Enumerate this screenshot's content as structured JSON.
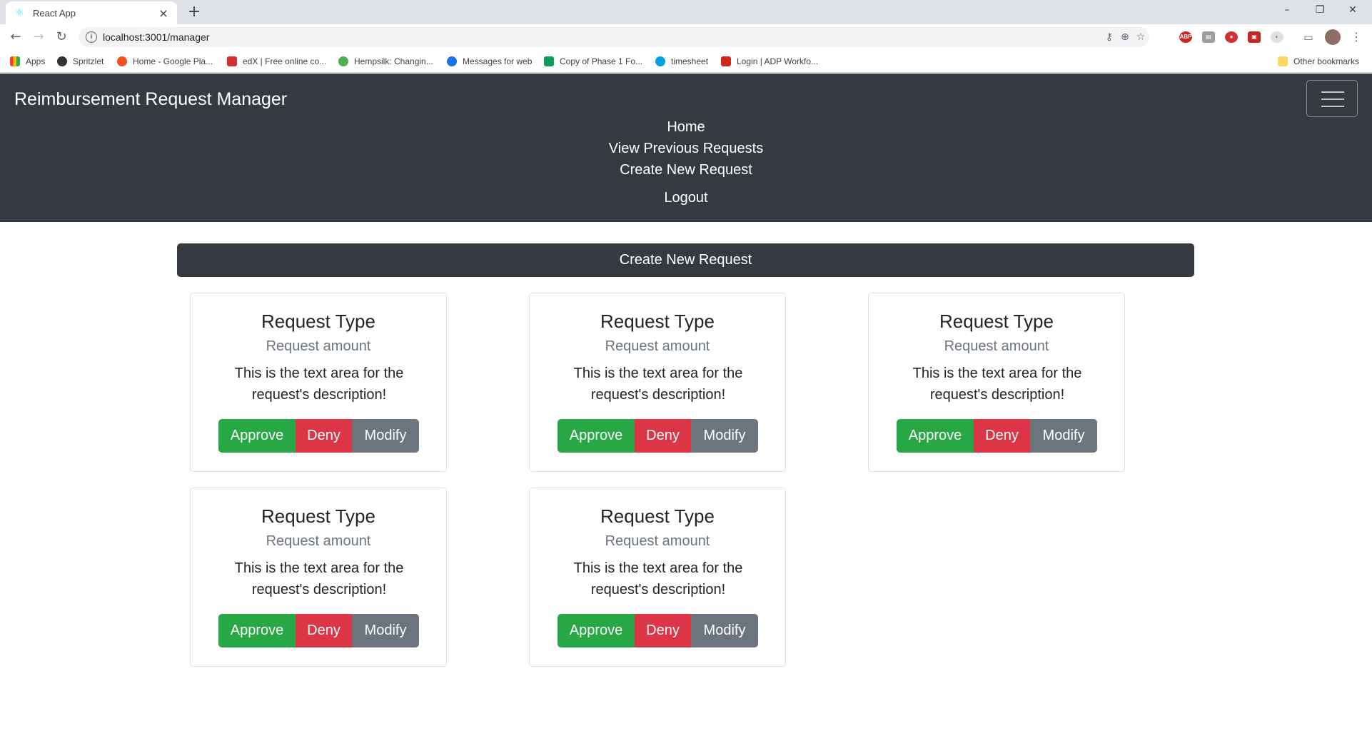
{
  "browser": {
    "tab_title": "React App",
    "url": "localhost:3001/manager",
    "bookmarks": [
      {
        "label": "Apps",
        "color": "#ea4335"
      },
      {
        "label": "Spritzlet",
        "color": "#333333"
      },
      {
        "label": "Home - Google Pla...",
        "color": "#f4511e"
      },
      {
        "label": "edX | Free online co...",
        "color": "#d32f2f"
      },
      {
        "label": "Hempsilk: Changin...",
        "color": "#4caf50"
      },
      {
        "label": "Messages for web",
        "color": "#1a73e8"
      },
      {
        "label": "Copy of Phase 1 Fo...",
        "color": "#0f9d58"
      },
      {
        "label": "timesheet",
        "color": "#00a1e0"
      },
      {
        "label": "Login | ADP Workfo...",
        "color": "#d0271d"
      }
    ],
    "other_bookmarks": "Other bookmarks"
  },
  "app": {
    "brand": "Reimbursement Request Manager",
    "nav": {
      "home": "Home",
      "previous": "View Previous Requests",
      "create": "Create New Request",
      "logout": "Logout"
    },
    "create_button": "Create New Request",
    "cards": [
      {
        "title": "Request Type",
        "subtitle": "Request amount",
        "text": "This is the text area for the request's description!",
        "approve": "Approve",
        "deny": "Deny",
        "modify": "Modify"
      },
      {
        "title": "Request Type",
        "subtitle": "Request amount",
        "text": "This is the text area for the request's description!",
        "approve": "Approve",
        "deny": "Deny",
        "modify": "Modify"
      },
      {
        "title": "Request Type",
        "subtitle": "Request amount",
        "text": "This is the text area for the request's description!",
        "approve": "Approve",
        "deny": "Deny",
        "modify": "Modify"
      },
      {
        "title": "Request Type",
        "subtitle": "Request amount",
        "text": "This is the text area for the request's description!",
        "approve": "Approve",
        "deny": "Deny",
        "modify": "Modify"
      },
      {
        "title": "Request Type",
        "subtitle": "Request amount",
        "text": "This is the text area for the request's description!",
        "approve": "Approve",
        "deny": "Deny",
        "modify": "Modify"
      }
    ]
  },
  "colors": {
    "navbar": "#343a40",
    "approve": "#28a745",
    "deny": "#dc3545",
    "modify": "#6c757d"
  }
}
